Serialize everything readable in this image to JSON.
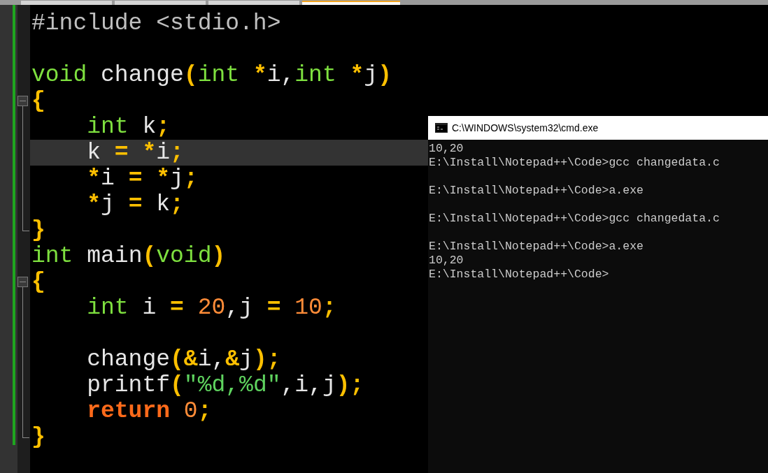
{
  "tabs": [
    {
      "selected": false
    },
    {
      "selected": false
    },
    {
      "selected": false
    },
    {
      "selected": true
    }
  ],
  "editor": {
    "lines": [
      {
        "current": false,
        "kind": "plain",
        "tokens": [
          {
            "kind": "pp",
            "text": "#include <stdio.h>"
          }
        ]
      },
      {
        "current": false,
        "kind": "plain"
      },
      {
        "current": false,
        "kind": "plain",
        "tokens": [
          {
            "kind": "kw",
            "text": "void"
          },
          {
            "kind": "id",
            "text": " change"
          },
          {
            "kind": "op",
            "text": "("
          },
          {
            "kind": "kw",
            "text": "int"
          },
          {
            "kind": "op",
            "text": " *"
          },
          {
            "kind": "id",
            "text": "i,"
          },
          {
            "kind": "kw",
            "text": "int"
          },
          {
            "kind": "op",
            "text": " *"
          },
          {
            "kind": "id",
            "text": "j"
          },
          {
            "kind": "op",
            "text": ")"
          }
        ]
      },
      {
        "current": false,
        "kind": "open",
        "tokens": [
          {
            "kind": "op",
            "text": "{"
          }
        ]
      },
      {
        "current": false,
        "kind": "body",
        "tokens": [
          {
            "kind": "kw",
            "text": "    int"
          },
          {
            "kind": "id",
            "text": " k"
          },
          {
            "kind": "op",
            "text": ";"
          }
        ]
      },
      {
        "current": true,
        "kind": "body",
        "tokens": [
          {
            "kind": "id",
            "text": "    k "
          },
          {
            "kind": "op",
            "text": "= *"
          },
          {
            "kind": "id",
            "text": "i"
          },
          {
            "kind": "op",
            "text": ";"
          }
        ]
      },
      {
        "current": false,
        "kind": "body",
        "tokens": [
          {
            "kind": "op",
            "text": "    *"
          },
          {
            "kind": "id",
            "text": "i "
          },
          {
            "kind": "op",
            "text": "= *"
          },
          {
            "kind": "id",
            "text": "j"
          },
          {
            "kind": "op",
            "text": ";"
          }
        ]
      },
      {
        "current": false,
        "kind": "body",
        "tokens": [
          {
            "kind": "op",
            "text": "    *"
          },
          {
            "kind": "id",
            "text": "j "
          },
          {
            "kind": "op",
            "text": "="
          },
          {
            "kind": "id",
            "text": " k"
          },
          {
            "kind": "op",
            "text": ";"
          }
        ]
      },
      {
        "current": false,
        "kind": "end",
        "tokens": [
          {
            "kind": "op",
            "text": "}"
          }
        ]
      },
      {
        "current": false,
        "kind": "plain",
        "tokens": [
          {
            "kind": "kw",
            "text": "int"
          },
          {
            "kind": "id",
            "text": " main"
          },
          {
            "kind": "op",
            "text": "("
          },
          {
            "kind": "kw",
            "text": "void"
          },
          {
            "kind": "op",
            "text": ")"
          }
        ]
      },
      {
        "current": false,
        "kind": "open",
        "tokens": [
          {
            "kind": "op",
            "text": "{"
          }
        ]
      },
      {
        "current": false,
        "kind": "body",
        "tokens": [
          {
            "kind": "kw",
            "text": "    int"
          },
          {
            "kind": "id",
            "text": " i "
          },
          {
            "kind": "op",
            "text": "="
          },
          {
            "kind": "num",
            "text": " 20"
          },
          {
            "kind": "id",
            "text": ",j "
          },
          {
            "kind": "op",
            "text": "="
          },
          {
            "kind": "num",
            "text": " 10"
          },
          {
            "kind": "op",
            "text": ";"
          }
        ]
      },
      {
        "current": false,
        "kind": "body"
      },
      {
        "current": false,
        "kind": "body",
        "tokens": [
          {
            "kind": "id",
            "text": "    change"
          },
          {
            "kind": "op",
            "text": "(&"
          },
          {
            "kind": "id",
            "text": "i,"
          },
          {
            "kind": "op",
            "text": "&"
          },
          {
            "kind": "id",
            "text": "j"
          },
          {
            "kind": "op",
            "text": ");"
          }
        ]
      },
      {
        "current": false,
        "kind": "body",
        "tokens": [
          {
            "kind": "id",
            "text": "    printf"
          },
          {
            "kind": "op",
            "text": "("
          },
          {
            "kind": "str",
            "text": "\"%d,%d\""
          },
          {
            "kind": "id",
            "text": ",i,j"
          },
          {
            "kind": "op",
            "text": ");"
          }
        ]
      },
      {
        "current": false,
        "kind": "body",
        "tokens": [
          {
            "kind": "ret",
            "text": "    return"
          },
          {
            "kind": "num",
            "text": " 0"
          },
          {
            "kind": "op",
            "text": ";"
          }
        ]
      },
      {
        "current": false,
        "kind": "end",
        "tokens": [
          {
            "kind": "op",
            "text": "}"
          }
        ]
      }
    ]
  },
  "console": {
    "title": "C:\\WINDOWS\\system32\\cmd.exe",
    "blocks": [
      [
        "10,20",
        "E:\\Install\\Notepad++\\Code>gcc changedata.c"
      ],
      [
        "E:\\Install\\Notepad++\\Code>a.exe"
      ],
      [
        "E:\\Install\\Notepad++\\Code>gcc changedata.c"
      ],
      [
        "E:\\Install\\Notepad++\\Code>a.exe",
        "10,20",
        "E:\\Install\\Notepad++\\Code>"
      ]
    ]
  }
}
